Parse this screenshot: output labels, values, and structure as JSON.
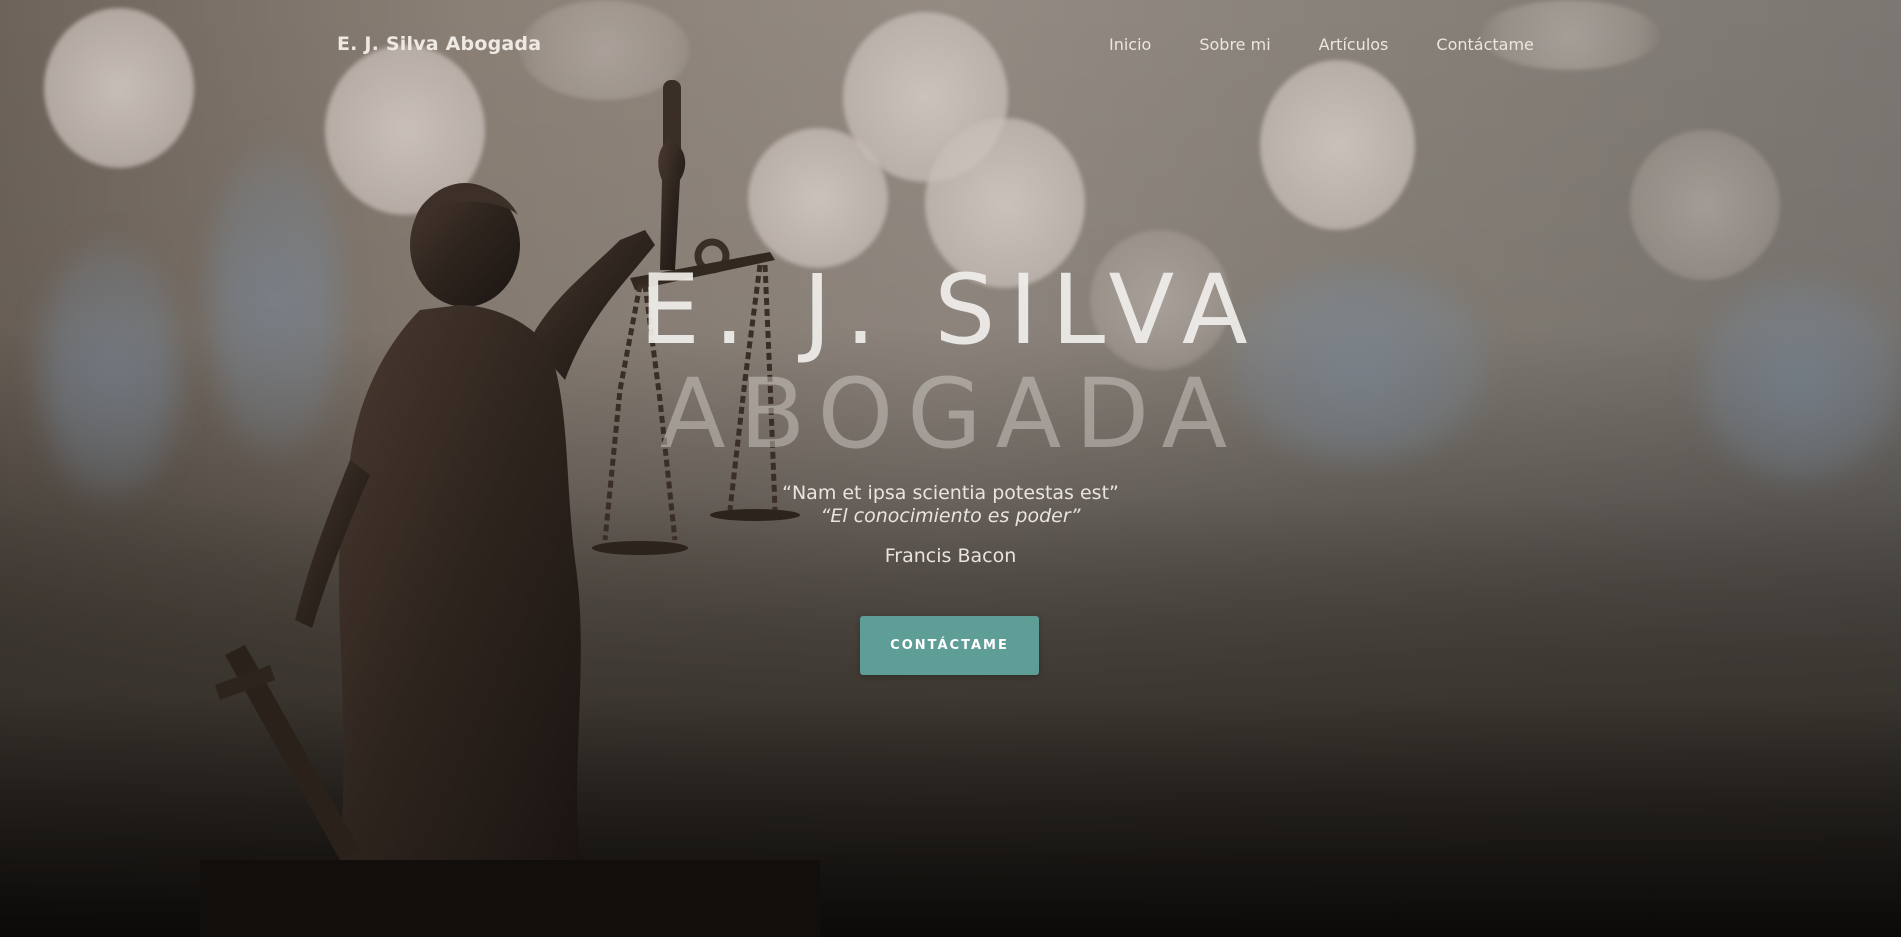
{
  "nav": {
    "brand": "E. J. Silva Abogada",
    "links": [
      {
        "label": "Inicio"
      },
      {
        "label": "Sobre mi"
      },
      {
        "label": "Artículos"
      },
      {
        "label": "Contáctame"
      }
    ]
  },
  "hero": {
    "title_line_1": "E. J. SILVA",
    "title_line_2": "ABOGADA",
    "quote_latin": "“Nam et ipsa scientia potestas est”",
    "quote_spanish": "“El conocimiento es poder”",
    "author": "Francis Bacon",
    "cta_label": "CONTÁCTAME"
  },
  "colors": {
    "cta_background": "#5f9e97",
    "text_light": "#f1efec"
  },
  "icons": {
    "background": "lady-justice-statue"
  }
}
